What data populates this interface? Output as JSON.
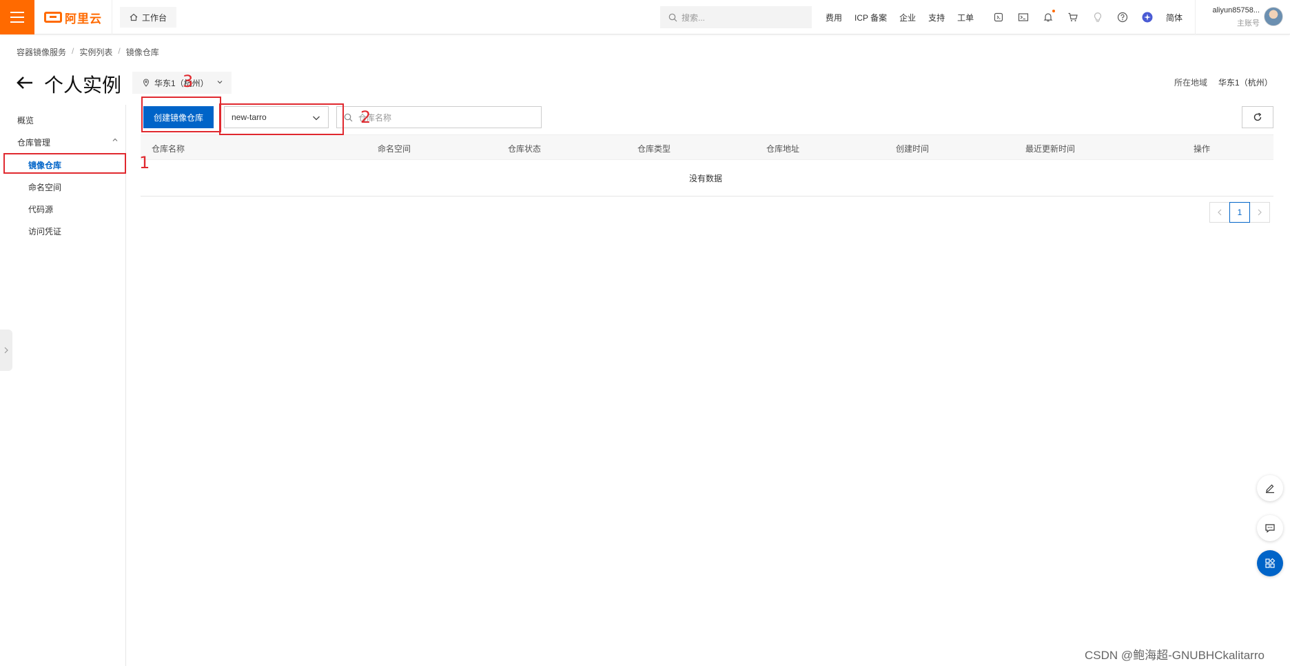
{
  "header": {
    "brand": "阿里云",
    "workbench": "工作台",
    "search_placeholder": "搜索...",
    "links": [
      "费用",
      "ICP 备案",
      "企业",
      "支持",
      "工单"
    ],
    "lang": "简体",
    "username": "aliyun85758...",
    "role": "主账号"
  },
  "breadcrumb": [
    "容器镜像服务",
    "实例列表",
    "镜像仓库"
  ],
  "page": {
    "title": "个人实例",
    "region": "华东1（杭州）",
    "region_label": "所在地域",
    "region_value": "华东1（杭州）"
  },
  "sidebar": {
    "overview": "概览",
    "repo_mgmt": "仓库管理",
    "items": [
      "镜像仓库",
      "命名空间",
      "代码源",
      "访问凭证"
    ]
  },
  "toolbar": {
    "create_label": "创建镜像仓库",
    "namespace": "new-tarro",
    "search_placeholder": "仓库名称"
  },
  "table": {
    "columns": [
      "仓库名称",
      "命名空间",
      "仓库状态",
      "仓库类型",
      "仓库地址",
      "创建时间",
      "最近更新时间",
      "操作"
    ],
    "empty_text": "没有数据"
  },
  "pagination": {
    "current": "1"
  },
  "annotations": [
    "1",
    "2",
    "3"
  ],
  "watermark": "CSDN @鲍海超-GNUBHCkalitarro",
  "colors": {
    "brand": "#ff6a00",
    "primary": "#0064c8",
    "annotation": "#e0282e"
  }
}
